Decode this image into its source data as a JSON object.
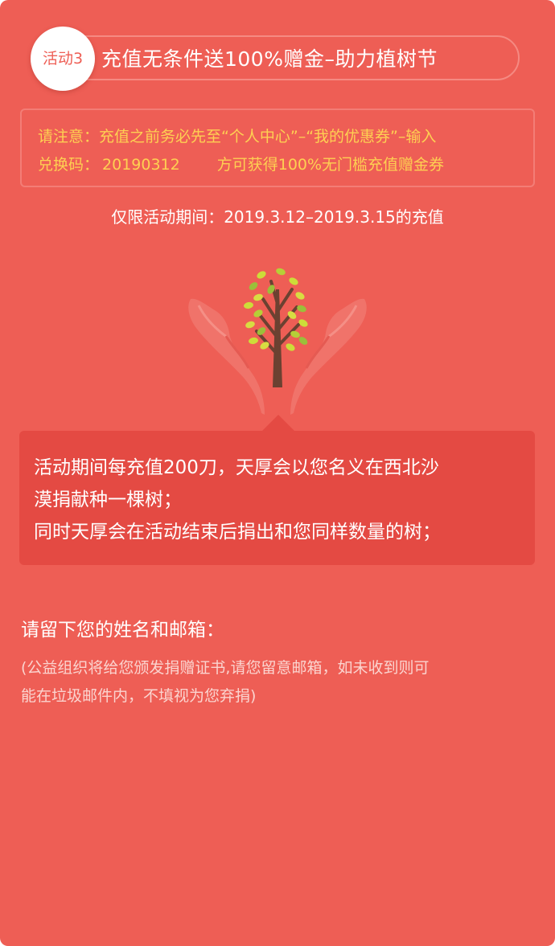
{
  "header": {
    "badge": "活动3",
    "title": "充值无条件送100%赠金–助力植树节"
  },
  "notice": {
    "line1": "请注意：充值之前务必先至“个人中心”–“我的优惠券”–输入",
    "line2_label": "兑换码：",
    "line2_code": "20190312",
    "line2_after": "方可获得100%无门槛充值赠金券"
  },
  "period": "仅限活动期间：2019.3.12–2019.3.15的充值",
  "callout": {
    "line1": "活动期间每充值200刀，天厚会以您名义在西北沙",
    "line2": "漠捐献种一棵树；",
    "line3": "同时天厚会在活动结束后捐出和您同样数量的树；"
  },
  "form": {
    "prompt": "请留下您的姓名和邮箱：",
    "note_line1": "(公益组织将给您颁发捐赠证书,请您留意邮箱，如未收到则可",
    "note_line2": "能在垃圾邮件内，不填视为您弃捐)"
  },
  "colors": {
    "background": "#ee5e55",
    "callout": "#e44a43",
    "notice_text": "#fed052",
    "badge_text": "#ee5e55"
  },
  "icons": {
    "illustration": "hands-holding-tree-icon"
  }
}
